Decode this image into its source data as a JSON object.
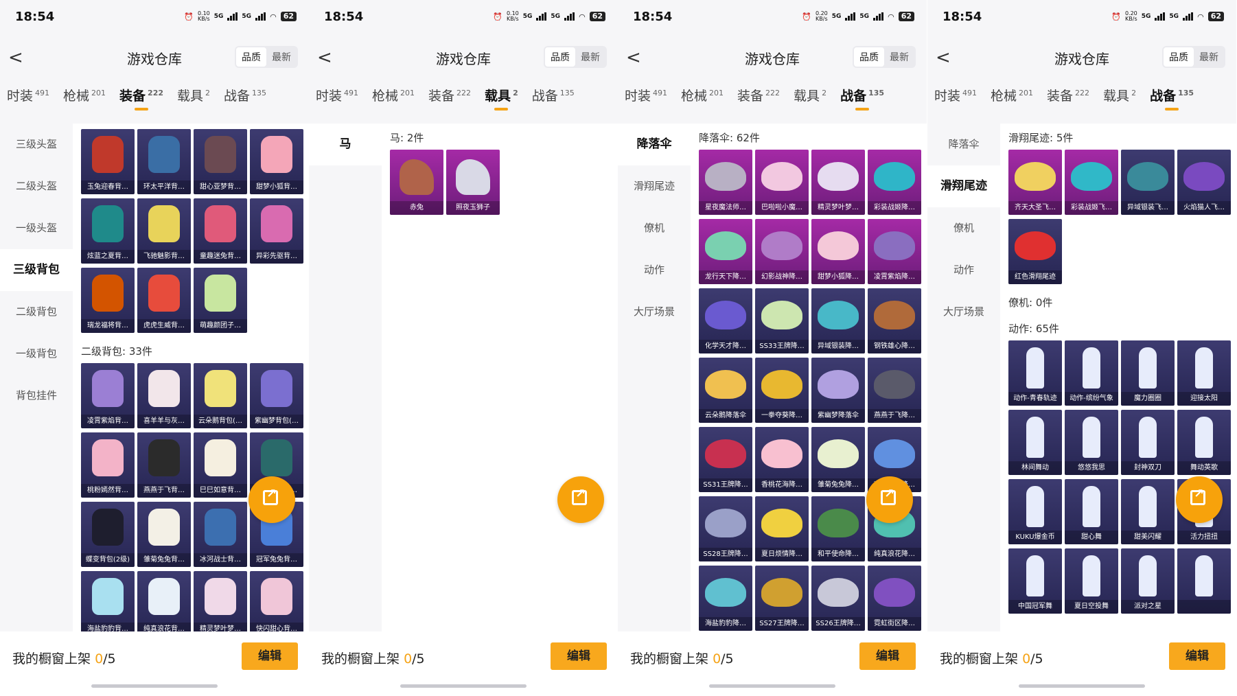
{
  "status": {
    "time": "18:54",
    "battery": "62",
    "net_speed_1": "0.10",
    "net_speed_2": "0.20",
    "net_unit": "KB/s",
    "sig1": "5G",
    "sig2": "5G"
  },
  "header": {
    "title": "游戏仓库",
    "sort_quality": "品质",
    "sort_newest": "最新"
  },
  "tabs": [
    {
      "label": "时装",
      "count": "491"
    },
    {
      "label": "枪械",
      "count": "201"
    },
    {
      "label": "装备",
      "count": "222"
    },
    {
      "label": "载具",
      "count": "2"
    },
    {
      "label": "战备",
      "count": "135"
    }
  ],
  "bottom": {
    "showcase_label": "我的橱窗上架",
    "showcase_count": "0",
    "showcase_max": "/5",
    "edit_label": "编辑"
  },
  "colors": {
    "accent": "#f5a316",
    "card_dark": "#2f2d5e",
    "card_pink": "#9b2aa0"
  },
  "fab_icon": "share-external-icon",
  "panels": [
    {
      "active_tab": 2,
      "sidebar": [
        {
          "label": "三级头盔",
          "active": false
        },
        {
          "label": "二级头盔",
          "active": false
        },
        {
          "label": "一级头盔",
          "active": false
        },
        {
          "label": "三级背包",
          "active": true
        },
        {
          "label": "二级背包",
          "active": false
        },
        {
          "label": "一级背包",
          "active": false
        },
        {
          "label": "背包挂件",
          "active": false
        }
      ],
      "sections": [
        {
          "title": "",
          "items": [
            {
              "label": "玉兔迎春背…",
              "tint": "#c0392b",
              "pink": false,
              "kind": "bag"
            },
            {
              "label": "环太平洋背…",
              "tint": "#3a6ea5",
              "pink": false,
              "kind": "bag"
            },
            {
              "label": "甜心亚梦背…",
              "tint": "#6b4a52",
              "pink": false,
              "kind": "bag"
            },
            {
              "label": "甜梦小狐背…",
              "tint": "#f4a6b8",
              "pink": false,
              "kind": "bag"
            },
            {
              "label": "炫蓝之夏背…",
              "tint": "#1f8a8a",
              "pink": false,
              "kind": "bag"
            },
            {
              "label": "飞驰魅影背…",
              "tint": "#e8d35a",
              "pink": false,
              "kind": "bag"
            },
            {
              "label": "童趣迷兔背…",
              "tint": "#e05a7a",
              "pink": false,
              "kind": "bag"
            },
            {
              "label": "异彩先驱背…",
              "tint": "#d96bb0",
              "pink": false,
              "kind": "bag"
            },
            {
              "label": "瑞龙福将背…",
              "tint": "#d35400",
              "pink": false,
              "kind": "bag"
            },
            {
              "label": "虎虎生威背…",
              "tint": "#e74c3c",
              "pink": false,
              "kind": "bag"
            },
            {
              "label": "萌趣颜团子…",
              "tint": "#c8e6a0",
              "pink": false,
              "kind": "bag"
            }
          ]
        },
        {
          "title": "二级背包: 33件",
          "items": [
            {
              "label": "凌霄紫焰背…",
              "tint": "#9b7fd4",
              "pink": false,
              "kind": "bag"
            },
            {
              "label": "喜羊羊与灰…",
              "tint": "#f2e6ea",
              "pink": false,
              "kind": "bag"
            },
            {
              "label": "云朵鹅背包(…",
              "tint": "#f0e27a",
              "pink": false,
              "kind": "bag"
            },
            {
              "label": "紫幽梦背包(…",
              "tint": "#7b6fd0",
              "pink": false,
              "kind": "bag"
            },
            {
              "label": "桃粉嫣然背…",
              "tint": "#f3b3c8",
              "pink": false,
              "kind": "bag"
            },
            {
              "label": "燕燕于飞背…",
              "tint": "#2b2b2b",
              "pink": false,
              "kind": "bag"
            },
            {
              "label": "巳巳如意背…",
              "tint": "#f5efe0",
              "pink": false,
              "kind": "bag"
            },
            {
              "label": "异域银装背…",
              "tint": "#2a6a6a",
              "pink": false,
              "kind": "bag"
            },
            {
              "label": "蝶变背包(2级)",
              "tint": "#1e1e2e",
              "pink": false,
              "kind": "bag"
            },
            {
              "label": "雏菊兔兔背…",
              "tint": "#f3f0e6",
              "pink": false,
              "kind": "bag"
            },
            {
              "label": "冰河战士背…",
              "tint": "#3c6fb0",
              "pink": false,
              "kind": "bag"
            },
            {
              "label": "冠军兔兔背…",
              "tint": "#4a7fd8",
              "pink": false,
              "kind": "bag"
            },
            {
              "label": "海盐豹豹背…",
              "tint": "#a9e0f0",
              "pink": false,
              "kind": "bag"
            },
            {
              "label": "纯真浪花背…",
              "tint": "#e8f0f8",
              "pink": false,
              "kind": "bag"
            },
            {
              "label": "精灵梦叶梦…",
              "tint": "#f0d9e8",
              "pink": false,
              "kind": "bag"
            },
            {
              "label": "快闪甜心背…",
              "tint": "#f0c6d8",
              "pink": false,
              "kind": "bag"
            }
          ]
        }
      ]
    },
    {
      "active_tab": 3,
      "sidebar": [
        {
          "label": "马",
          "active": true
        }
      ],
      "sections": [
        {
          "title": "马: 2件",
          "items": [
            {
              "label": "赤兔",
              "tint": "#b0634a",
              "pink": true,
              "kind": "horse"
            },
            {
              "label": "照夜玉狮子",
              "tint": "#d9d9e6",
              "pink": true,
              "kind": "horse"
            }
          ]
        }
      ]
    },
    {
      "active_tab": 4,
      "sidebar": [
        {
          "label": "降落伞",
          "active": true
        },
        {
          "label": "滑翔尾迹",
          "active": false
        },
        {
          "label": "僚机",
          "active": false
        },
        {
          "label": "动作",
          "active": false
        },
        {
          "label": "大厅场景",
          "active": false
        }
      ],
      "sections": [
        {
          "title": "降落伞: 62件",
          "items": [
            {
              "label": "星夜魔法师…",
              "tint": "#b8b0c4",
              "pink": true,
              "kind": "para"
            },
            {
              "label": "巴啦啦小魔…",
              "tint": "#f2c8e0",
              "pink": true,
              "kind": "para"
            },
            {
              "label": "精灵梦叶梦…",
              "tint": "#e6dcf0",
              "pink": true,
              "kind": "para"
            },
            {
              "label": "彩装战姬降…",
              "tint": "#2fb5c8",
              "pink": true,
              "kind": "para"
            },
            {
              "label": "龙行天下降…",
              "tint": "#7ad0b0",
              "pink": true,
              "kind": "para"
            },
            {
              "label": "幻影战神降…",
              "tint": "#b07cc8",
              "pink": true,
              "kind": "para"
            },
            {
              "label": "甜梦小狐降…",
              "tint": "#f4c8d8",
              "pink": true,
              "kind": "para"
            },
            {
              "label": "凌霄紫焰降…",
              "tint": "#8a6ec0",
              "pink": true,
              "kind": "para"
            },
            {
              "label": "化学天才降…",
              "tint": "#6a5ad0",
              "pink": false,
              "kind": "para"
            },
            {
              "label": "SS33王牌降…",
              "tint": "#cde6b0",
              "pink": false,
              "kind": "para"
            },
            {
              "label": "异域银装降…",
              "tint": "#48b8c8",
              "pink": false,
              "kind": "para"
            },
            {
              "label": "钢铁雄心降…",
              "tint": "#b06a3a",
              "pink": false,
              "kind": "para"
            },
            {
              "label": "云朵鹅降落伞",
              "tint": "#f0c050",
              "pink": false,
              "kind": "para"
            },
            {
              "label": "一拳夺葵降…",
              "tint": "#e8b830",
              "pink": false,
              "kind": "para"
            },
            {
              "label": "紫幽梦降落伞",
              "tint": "#b0a0e0",
              "pink": false,
              "kind": "para"
            },
            {
              "label": "燕燕于飞降…",
              "tint": "#5a5a6a",
              "pink": false,
              "kind": "para"
            },
            {
              "label": "SS31王牌降…",
              "tint": "#c83050",
              "pink": false,
              "kind": "para"
            },
            {
              "label": "香桃花海降…",
              "tint": "#f8c0d0",
              "pink": false,
              "kind": "para"
            },
            {
              "label": "雏菊兔兔降…",
              "tint": "#e8f0d0",
              "pink": false,
              "kind": "para"
            },
            {
              "label": "冰河战士降…",
              "tint": "#6090e0",
              "pink": false,
              "kind": "para"
            },
            {
              "label": "SS28王牌降…",
              "tint": "#9aa0c8",
              "pink": false,
              "kind": "para"
            },
            {
              "label": "夏日烦情降…",
              "tint": "#f0d040",
              "pink": false,
              "kind": "para"
            },
            {
              "label": "和平使命降…",
              "tint": "#4a8a4a",
              "pink": false,
              "kind": "para"
            },
            {
              "label": "纯真浪花降…",
              "tint": "#50c0b0",
              "pink": false,
              "kind": "para"
            },
            {
              "label": "海盐豹豹降…",
              "tint": "#60c0d0",
              "pink": false,
              "kind": "para"
            },
            {
              "label": "SS27王牌降…",
              "tint": "#d0a030",
              "pink": false,
              "kind": "para"
            },
            {
              "label": "SS26王牌降…",
              "tint": "#c8c8d8",
              "pink": false,
              "kind": "para"
            },
            {
              "label": "霓虹街区降…",
              "tint": "#8050c0",
              "pink": false,
              "kind": "para"
            }
          ]
        }
      ]
    },
    {
      "active_tab": 4,
      "sidebar": [
        {
          "label": "降落伞",
          "active": false
        },
        {
          "label": "滑翔尾迹",
          "active": true
        },
        {
          "label": "僚机",
          "active": false
        },
        {
          "label": "动作",
          "active": false
        },
        {
          "label": "大厅场景",
          "active": false
        }
      ],
      "sections": [
        {
          "title": "滑翔尾迹: 5件",
          "items": [
            {
              "label": "齐天大圣飞…",
              "tint": "#f0d060",
              "pink": true,
              "kind": "para"
            },
            {
              "label": "彩装战姬飞…",
              "tint": "#30b8c8",
              "pink": true,
              "kind": "para"
            },
            {
              "label": "异域银装飞…",
              "tint": "#3a8a9a",
              "pink": false,
              "kind": "para"
            },
            {
              "label": "火焰猫人飞…",
              "tint": "#7a4ac0",
              "pink": false,
              "kind": "para"
            },
            {
              "label": "红色滑翔尾迹",
              "tint": "#e03030",
              "pink": false,
              "kind": "para"
            }
          ]
        },
        {
          "title": "僚机: 0件",
          "items": []
        },
        {
          "title": "动作: 65件",
          "items": [
            {
              "label": "动作-青春轨迹",
              "tint": "#e8ecfa",
              "pink": false,
              "kind": "dance"
            },
            {
              "label": "动作-缤纷气象",
              "tint": "#e8ecfa",
              "pink": false,
              "kind": "dance"
            },
            {
              "label": "魔力圈圈",
              "tint": "#e8ecfa",
              "pink": false,
              "kind": "dance"
            },
            {
              "label": "迎接太阳",
              "tint": "#e8ecfa",
              "pink": false,
              "kind": "dance"
            },
            {
              "label": "林间舞动",
              "tint": "#e8ecfa",
              "pink": false,
              "kind": "dance"
            },
            {
              "label": "悠悠我思",
              "tint": "#e8ecfa",
              "pink": false,
              "kind": "dance"
            },
            {
              "label": "封神双刀",
              "tint": "#e8ecfa",
              "pink": false,
              "kind": "dance"
            },
            {
              "label": "舞动英歌",
              "tint": "#e8ecfa",
              "pink": false,
              "kind": "dance"
            },
            {
              "label": "KUKU爆金币",
              "tint": "#e8ecfa",
              "pink": false,
              "kind": "dance"
            },
            {
              "label": "甜心舞",
              "tint": "#e8ecfa",
              "pink": false,
              "kind": "dance"
            },
            {
              "label": "甜美闪耀",
              "tint": "#e8ecfa",
              "pink": false,
              "kind": "dance"
            },
            {
              "label": "活力扭扭",
              "tint": "#e8ecfa",
              "pink": false,
              "kind": "dance"
            },
            {
              "label": "中国冠军舞",
              "tint": "#e8ecfa",
              "pink": false,
              "kind": "dance"
            },
            {
              "label": "夏日空投舞",
              "tint": "#e8ecfa",
              "pink": false,
              "kind": "dance"
            },
            {
              "label": "派对之星",
              "tint": "#e8ecfa",
              "pink": false,
              "kind": "dance"
            },
            {
              "label": "",
              "tint": "#e8ecfa",
              "pink": false,
              "kind": "dance"
            }
          ]
        }
      ]
    }
  ]
}
